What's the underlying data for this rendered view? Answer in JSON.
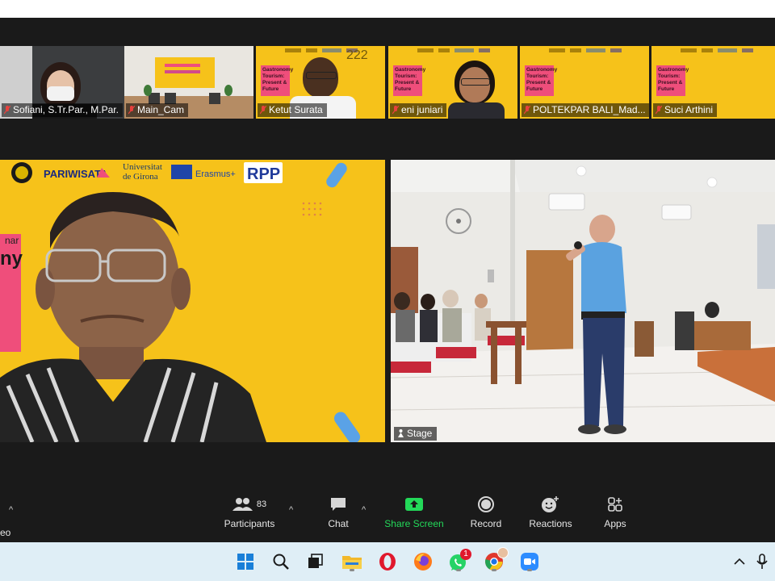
{
  "participants_strip": [
    {
      "name": "Sofiani, S.Tr.Par., M.Par."
    },
    {
      "name": "Main_Cam"
    },
    {
      "name": "Ketut Surata"
    },
    {
      "name": "eni juniari"
    },
    {
      "name": "POLTEKPAR BALI_Mad..."
    },
    {
      "name": "Suci Arthini"
    }
  ],
  "slide_thumb_text": "Gastronomy Tourism: Present & Future",
  "slide_thumb_badge": "222",
  "main_left": {
    "logo_text": "PARIWISATA",
    "univ_line1": "Universitat",
    "univ_line2": "de Girona",
    "erasmus": "Erasmus+",
    "slide_fragment_1": "nar",
    "slide_fragment_2": "ny"
  },
  "main_right": {
    "label": "Stage"
  },
  "toolbar": {
    "video_fragment": "eo",
    "participants_label": "Participants",
    "participants_count": "83",
    "chat_label": "Chat",
    "share_label": "Share Screen",
    "record_label": "Record",
    "reactions_label": "Reactions",
    "apps_label": "Apps"
  },
  "taskbar": {
    "whatsapp_badge": "1"
  },
  "colors": {
    "slide_yellow": "#f6c21a",
    "share_green": "#23d959",
    "pink": "#ef4e7b"
  }
}
